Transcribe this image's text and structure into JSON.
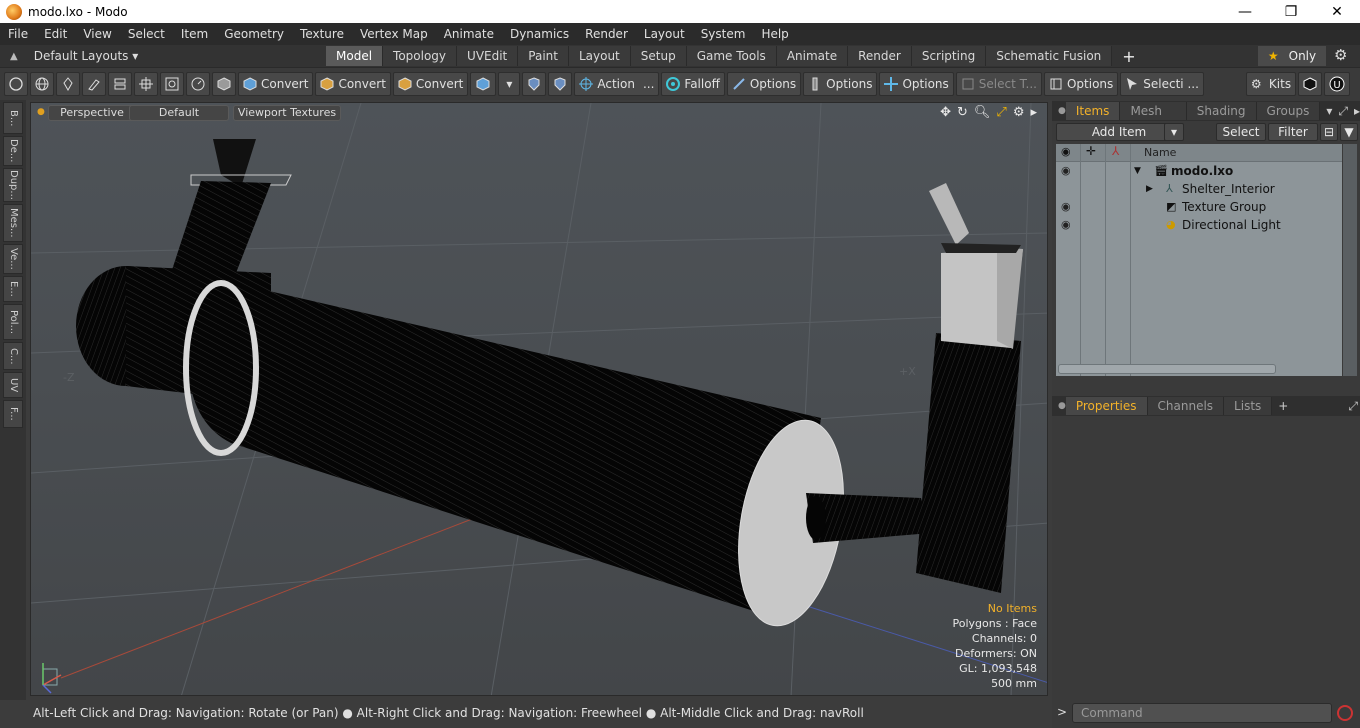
{
  "window": {
    "title": "modo.lxo - Modo",
    "minimize": "—",
    "maximize": "❐",
    "close": "✕"
  },
  "menu": [
    "File",
    "Edit",
    "View",
    "Select",
    "Item",
    "Geometry",
    "Texture",
    "Vertex Map",
    "Animate",
    "Dynamics",
    "Render",
    "Layout",
    "System",
    "Help"
  ],
  "layouts": {
    "dropdown": "Default Layouts ▾",
    "tabs": [
      "Model",
      "Topology",
      "UVEdit",
      "Paint",
      "Layout",
      "Setup",
      "Game Tools",
      "Animate",
      "Render",
      "Scripting",
      "Schematic Fusion"
    ],
    "active": "Model",
    "only": "Only"
  },
  "toolbar": {
    "convert1": "Convert",
    "convert2": "Convert",
    "convert3": "Convert",
    "action": "Action",
    "action_more": "...",
    "falloff": "Falloff",
    "options1": "Options",
    "options2": "Options",
    "options3": "Options",
    "select_t": "Select T...",
    "options4": "Options",
    "selecti": "Selecti ...",
    "kits": "Kits"
  },
  "left_tabs": [
    "B...",
    "De...",
    "Dup...",
    "Mes...",
    "Ve...",
    "E...",
    "Pol...",
    "C...",
    "UV",
    "F..."
  ],
  "viewport": {
    "view": "Perspective",
    "shading": "Default",
    "textures": "Viewport Textures",
    "axis_z": "-Z",
    "axis_x": "+X",
    "stats": {
      "no_items": "No Items",
      "polygons": "Polygons : Face",
      "channels": "Channels: 0",
      "deformers": "Deformers: ON",
      "gl": "GL: 1,093,548",
      "scale": "500 mm"
    }
  },
  "status": "Alt-Left Click and Drag: Navigation: Rotate (or Pan) ● Alt-Right Click and Drag: Navigation: Freewheel ● Alt-Middle Click and Drag: navRoll",
  "items_panel": {
    "tabs": [
      "Items",
      "Mesh ...",
      "Shading",
      "Groups"
    ],
    "active": "Items",
    "add_item": "Add Item",
    "select": "Select",
    "filter": "Filter",
    "col_name": "Name",
    "rows": [
      {
        "name": "modo.lxo",
        "bold": true
      },
      {
        "name": "Shelter_Interior",
        "bold": false
      },
      {
        "name": "Texture Group",
        "bold": false
      },
      {
        "name": "Directional Light",
        "bold": false
      }
    ]
  },
  "props_panel": {
    "tabs": [
      "Properties",
      "Channels",
      "Lists"
    ],
    "active": "Properties",
    "plus": "+"
  },
  "command": {
    "prompt": ">",
    "placeholder": "Command"
  },
  "colors": {
    "accent": "#f2b12a",
    "viewport_bg": "#4a4e52",
    "panel_bg": "#3a3a3a",
    "list_bg": "#8d9599"
  }
}
